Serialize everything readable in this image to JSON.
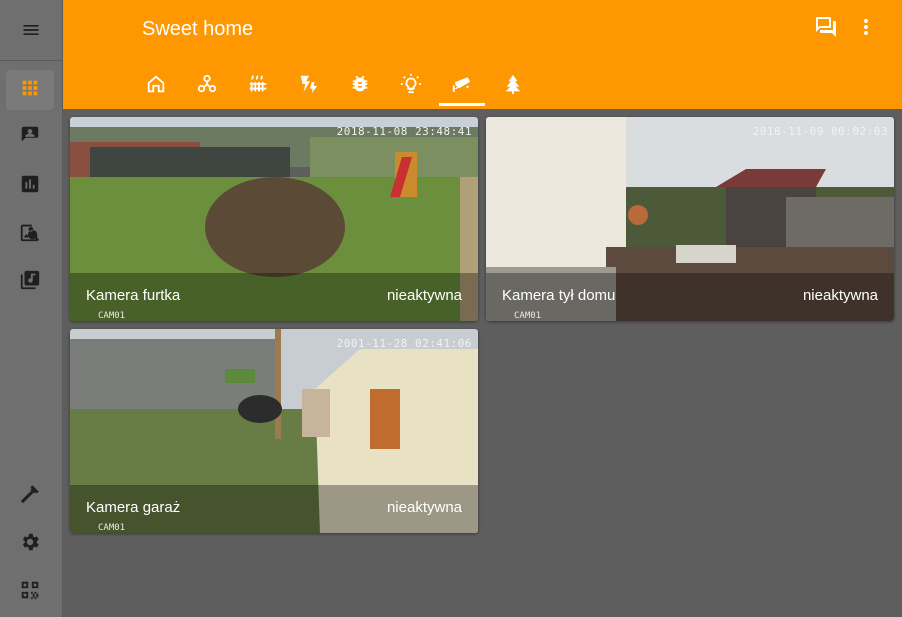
{
  "app": {
    "title": "Sweet home",
    "accent_color": "#ff9800"
  },
  "sidebar": {
    "menu_icon": "menu-icon",
    "items": [
      {
        "icon": "apps-icon",
        "active": true
      },
      {
        "icon": "account-box-icon",
        "active": false
      },
      {
        "icon": "chart-bar-icon",
        "active": false
      },
      {
        "icon": "image-search-icon",
        "active": false
      },
      {
        "icon": "music-box-icon",
        "active": false
      }
    ],
    "bottom_items": [
      {
        "icon": "hammer-icon"
      },
      {
        "icon": "cog-icon"
      },
      {
        "icon": "qrcode-icon"
      }
    ]
  },
  "header": {
    "actions": [
      {
        "icon": "chat-icon"
      },
      {
        "icon": "dots-vertical-icon"
      }
    ]
  },
  "tabs": [
    {
      "icon": "home-icon",
      "active": false
    },
    {
      "icon": "hubspot-icon",
      "active": false
    },
    {
      "icon": "radiator-icon",
      "active": false
    },
    {
      "icon": "flash-icon",
      "active": false
    },
    {
      "icon": "bug-icon",
      "active": false
    },
    {
      "icon": "lightbulb-icon",
      "active": false
    },
    {
      "icon": "cctv-icon",
      "active": true
    },
    {
      "icon": "tree-icon",
      "active": false
    }
  ],
  "cameras": [
    {
      "name": "Kamera furtka",
      "state": "nieaktywna",
      "timestamp": "2018-11-08 23:48:41",
      "cam_id": "CAM01"
    },
    {
      "name": "Kamera tył domu",
      "state": "nieaktywna",
      "timestamp": "2018-11-09 00:02:03",
      "cam_id": "CAM01"
    },
    {
      "name": "Kamera garaż",
      "state": "nieaktywna",
      "timestamp": "2001-11-28 02:41:06",
      "cam_id": "CAM01"
    }
  ]
}
